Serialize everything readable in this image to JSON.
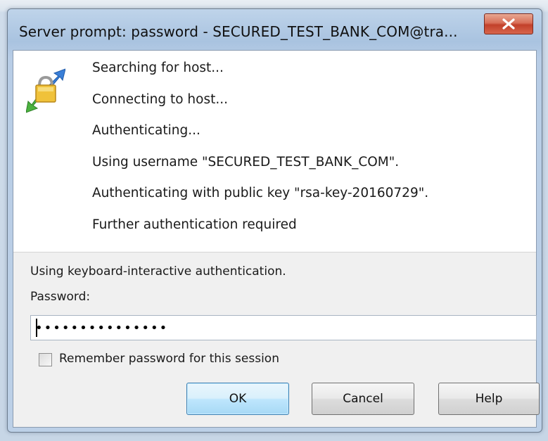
{
  "window": {
    "title": "Server prompt: password - SECURED_TEST_BANK_COM@tra..."
  },
  "log": {
    "lines": [
      "Searching for host...",
      "Connecting to host...",
      "Authenticating...",
      "Using username \"SECURED_TEST_BANK_COM\".",
      "Authenticating with public key \"rsa-key-20160729\".",
      "Further authentication required"
    ]
  },
  "prompt": {
    "info": "Using keyboard-interactive authentication.",
    "password_label": "Password:",
    "password_value": "•••••••••••••••"
  },
  "options": {
    "remember_label": "Remember password for this session",
    "remember_checked": false
  },
  "buttons": {
    "ok": "OK",
    "cancel": "Cancel",
    "help": "Help"
  },
  "colors": {
    "titlebar": "#a9c3e0",
    "close_button": "#c2402a",
    "default_button": "#bee6fd"
  },
  "icons": {
    "app": "lock-arrows-icon",
    "close": "close-icon"
  }
}
